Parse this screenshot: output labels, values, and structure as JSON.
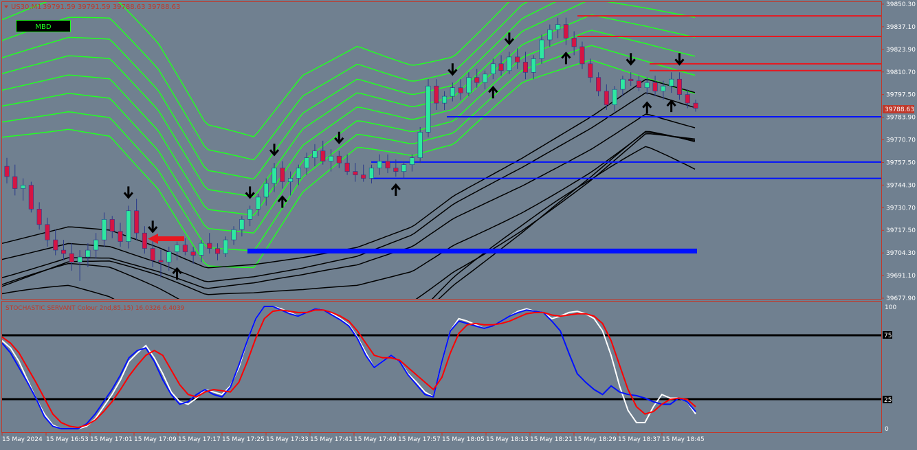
{
  "chart_header": {
    "symbol": "US30,M1",
    "ohlc": "39791.59 39791.59 39788.63 39788.63"
  },
  "badge": {
    "label": "MBD"
  },
  "price_axis": {
    "ticks": [
      "39850.30",
      "39837.10",
      "39823.90",
      "39810.70",
      "39797.50",
      "39783.90",
      "39770.70",
      "39757.50",
      "39744.30",
      "39730.70",
      "39717.50",
      "39704.30",
      "39691.10",
      "39677.90"
    ],
    "current_price": "39788.63"
  },
  "indicator": {
    "label": "STOCHASTIC SERVANT Colour 2nd,85,15) 16.0326 6.4039",
    "axis": [
      "100",
      "75",
      "25",
      "0"
    ]
  },
  "time_axis": [
    "15 May 2024",
    "15 May 16:53",
    "15 May 17:01",
    "15 May 17:09",
    "15 May 17:17",
    "15 May 17:25",
    "15 May 17:33",
    "15 May 17:41",
    "15 May 17:49",
    "15 May 17:57",
    "15 May 18:05",
    "15 May 18:13",
    "15 May 18:21",
    "15 May 18:29",
    "15 May 18:37",
    "15 May 18:45"
  ],
  "colors": {
    "background": "#708090",
    "grid_border": "#c0392b",
    "bull": "#2ee8a0",
    "bear": "#d51443",
    "upper_bands": "#22ff22",
    "lower_bands": "#000000",
    "support": "#0010ff",
    "resistance": "#e8171f",
    "stoch_main": "#ffffff",
    "stoch_signal": "#ff0000",
    "stoch_fast": "#0010ff"
  },
  "chart_data": {
    "type": "candlestick",
    "timeframe": "M1",
    "symbol": "US30",
    "ylim": [
      39677.9,
      39850.3
    ],
    "last_price": 39788.63,
    "candles": [
      [
        39755,
        39760,
        39745,
        39749
      ],
      [
        39749,
        39756,
        39738,
        39742
      ],
      [
        39742,
        39748,
        39735,
        39744
      ],
      [
        39744,
        39746,
        39728,
        39730
      ],
      [
        39730,
        39734,
        39718,
        39721
      ],
      [
        39721,
        39725,
        39708,
        39712
      ],
      [
        39712,
        39718,
        39703,
        39706
      ],
      [
        39706,
        39712,
        39700,
        39704
      ],
      [
        39704,
        39710,
        39694,
        39699
      ],
      [
        39699,
        39706,
        39688,
        39702
      ],
      [
        39702,
        39710,
        39696,
        39706
      ],
      [
        39706,
        39716,
        39701,
        39712
      ],
      [
        39712,
        39728,
        39708,
        39724
      ],
      [
        39724,
        39726,
        39713,
        39717
      ],
      [
        39717,
        39722,
        39708,
        39711
      ],
      [
        39711,
        39732,
        39707,
        39729
      ],
      [
        39729,
        39736,
        39712,
        39716
      ],
      [
        39716,
        39720,
        39704,
        39707
      ],
      [
        39707,
        39712,
        39696,
        39700
      ],
      [
        39700,
        39706,
        39690,
        39699
      ],
      [
        39699,
        39708,
        39694,
        39705
      ],
      [
        39705,
        39711,
        39700,
        39709
      ],
      [
        39709,
        39713,
        39703,
        39705
      ],
      [
        39705,
        39708,
        39698,
        39703
      ],
      [
        39703,
        39712,
        39699,
        39710
      ],
      [
        39710,
        39716,
        39704,
        39707
      ],
      [
        39707,
        39710,
        39700,
        39704
      ],
      [
        39704,
        39714,
        39702,
        39712
      ],
      [
        39712,
        39720,
        39709,
        39718
      ],
      [
        39718,
        39726,
        39714,
        39724
      ],
      [
        39724,
        39732,
        39720,
        39730
      ],
      [
        39730,
        39739,
        39726,
        39737
      ],
      [
        39737,
        39748,
        39732,
        39745
      ],
      [
        39745,
        39757,
        39740,
        39754
      ],
      [
        39754,
        39758,
        39742,
        39746
      ],
      [
        39746,
        39752,
        39738,
        39748
      ],
      [
        39748,
        39756,
        39744,
        39754
      ],
      [
        39754,
        39763,
        39750,
        39760
      ],
      [
        39760,
        39768,
        39755,
        39764
      ],
      [
        39764,
        39770,
        39756,
        39758
      ],
      [
        39758,
        39765,
        39752,
        39761
      ],
      [
        39761,
        39764,
        39754,
        39757
      ],
      [
        39757,
        39762,
        39750,
        39752
      ],
      [
        39752,
        39757,
        39746,
        39750
      ],
      [
        39750,
        39756,
        39746,
        39748
      ],
      [
        39748,
        39756,
        39745,
        39754
      ],
      [
        39754,
        39762,
        39750,
        39758
      ],
      [
        39758,
        39762,
        39751,
        39754
      ],
      [
        39754,
        39759,
        39749,
        39752
      ],
      [
        39752,
        39758,
        39748,
        39756
      ],
      [
        39756,
        39762,
        39752,
        39760
      ],
      [
        39760,
        39778,
        39757,
        39775
      ],
      [
        39775,
        39806,
        39772,
        39802
      ],
      [
        39802,
        39806,
        39788,
        39792
      ],
      [
        39792,
        39799,
        39788,
        39796
      ],
      [
        39796,
        39804,
        39793,
        39801
      ],
      [
        39801,
        39806,
        39794,
        39798
      ],
      [
        39798,
        39810,
        39796,
        39807
      ],
      [
        39807,
        39812,
        39801,
        39804
      ],
      [
        39804,
        39811,
        39800,
        39809
      ],
      [
        39809,
        39818,
        39806,
        39815
      ],
      [
        39815,
        39820,
        39808,
        39811
      ],
      [
        39811,
        39822,
        39809,
        39819
      ],
      [
        39819,
        39824,
        39812,
        39816
      ],
      [
        39816,
        39822,
        39806,
        39810
      ],
      [
        39810,
        39820,
        39806,
        39818
      ],
      [
        39818,
        39832,
        39815,
        39829
      ],
      [
        39829,
        39838,
        39825,
        39835
      ],
      [
        39835,
        39842,
        39830,
        39838
      ],
      [
        39838,
        39842,
        39826,
        39830
      ],
      [
        39830,
        39834,
        39820,
        39825
      ],
      [
        39825,
        39828,
        39812,
        39815
      ],
      [
        39815,
        39818,
        39804,
        39807
      ],
      [
        39807,
        39810,
        39796,
        39799
      ],
      [
        39799,
        39803,
        39788,
        39791
      ],
      [
        39791,
        39802,
        39787,
        39800
      ],
      [
        39800,
        39808,
        39796,
        39806
      ],
      [
        39806,
        39810,
        39802,
        39805
      ],
      [
        39805,
        39808,
        39799,
        39801
      ],
      [
        39801,
        39807,
        39797,
        39804
      ],
      [
        39804,
        39808,
        39796,
        39799
      ],
      [
        39799,
        39805,
        39794,
        39802
      ],
      [
        39802,
        39810,
        39798,
        39806
      ],
      [
        39806,
        39810,
        39794,
        39797
      ],
      [
        39797,
        39800,
        39789,
        39792
      ],
      [
        39792,
        39794,
        39787,
        39789
      ]
    ],
    "signals": [
      {
        "index": 15,
        "type": "sell"
      },
      {
        "index": 18,
        "type": "sell"
      },
      {
        "index": 30,
        "type": "sell"
      },
      {
        "index": 33,
        "type": "sell"
      },
      {
        "index": 41,
        "type": "sell"
      },
      {
        "index": 55,
        "type": "sell"
      },
      {
        "index": 62,
        "type": "sell"
      },
      {
        "index": 77,
        "type": "sell"
      },
      {
        "index": 83,
        "type": "sell"
      },
      {
        "index": 21,
        "type": "buy"
      },
      {
        "index": 34,
        "type": "buy"
      },
      {
        "index": 48,
        "type": "buy"
      },
      {
        "index": 60,
        "type": "buy"
      },
      {
        "index": 69,
        "type": "buy"
      },
      {
        "index": 79,
        "type": "buy"
      },
      {
        "index": 82,
        "type": "buy"
      }
    ],
    "horizontal_levels": [
      {
        "price": 39843,
        "kind": "resistance"
      },
      {
        "price": 39831,
        "kind": "resistance"
      },
      {
        "price": 39815,
        "kind": "resistance"
      },
      {
        "price": 39811,
        "kind": "resistance"
      },
      {
        "price": 39784,
        "kind": "support"
      },
      {
        "price": 39757.5,
        "kind": "support"
      },
      {
        "price": 39748,
        "kind": "support"
      },
      {
        "price": 39705.5,
        "kind": "support"
      }
    ],
    "stochastic": {
      "levels": [
        75,
        25
      ],
      "main": [
        72,
        66,
        55,
        40,
        25,
        12,
        3,
        0,
        0,
        0,
        2,
        8,
        18,
        28,
        40,
        55,
        62,
        68,
        58,
        45,
        30,
        22,
        20,
        25,
        32,
        30,
        28,
        35,
        50,
        72,
        90,
        100,
        100,
        98,
        95,
        92,
        95,
        98,
        97,
        94,
        90,
        85,
        75,
        62,
        50,
        55,
        60,
        55,
        45,
        38,
        30,
        26,
        55,
        80,
        90,
        88,
        85,
        82,
        84,
        88,
        92,
        96,
        98,
        96,
        95,
        90,
        92,
        95,
        96,
        94,
        90,
        80,
        60,
        35,
        15,
        5,
        5,
        18,
        28,
        25,
        25,
        22,
        12
      ],
      "signal": [
        75,
        70,
        62,
        50,
        38,
        25,
        12,
        5,
        2,
        1,
        3,
        7,
        14,
        22,
        32,
        43,
        52,
        60,
        64,
        60,
        48,
        36,
        28,
        26,
        30,
        32,
        31,
        30,
        38,
        55,
        74,
        90,
        96,
        97,
        96,
        95,
        95,
        97,
        97,
        95,
        92,
        88,
        80,
        70,
        60,
        58,
        58,
        56,
        50,
        44,
        38,
        32,
        42,
        62,
        78,
        85,
        86,
        85,
        85,
        86,
        88,
        91,
        94,
        95,
        95,
        93,
        92,
        93,
        94,
        94,
        92,
        86,
        72,
        52,
        32,
        18,
        12,
        14,
        20,
        24,
        25,
        24,
        18
      ],
      "fast": [
        70,
        62,
        50,
        38,
        25,
        10,
        2,
        0,
        0,
        0,
        4,
        12,
        22,
        32,
        44,
        58,
        64,
        66,
        55,
        40,
        28,
        20,
        22,
        28,
        32,
        28,
        26,
        34,
        52,
        72,
        90,
        100,
        100,
        97,
        94,
        92,
        95,
        98,
        97,
        93,
        89,
        84,
        74,
        60,
        50,
        55,
        60,
        55,
        44,
        36,
        28,
        26,
        55,
        80,
        88,
        86,
        84,
        82,
        84,
        88,
        92,
        95,
        97,
        96,
        95,
        88,
        80,
        62,
        45,
        38,
        32,
        28,
        35,
        30,
        28,
        27,
        25,
        22,
        20,
        20,
        25,
        22,
        14
      ]
    }
  }
}
